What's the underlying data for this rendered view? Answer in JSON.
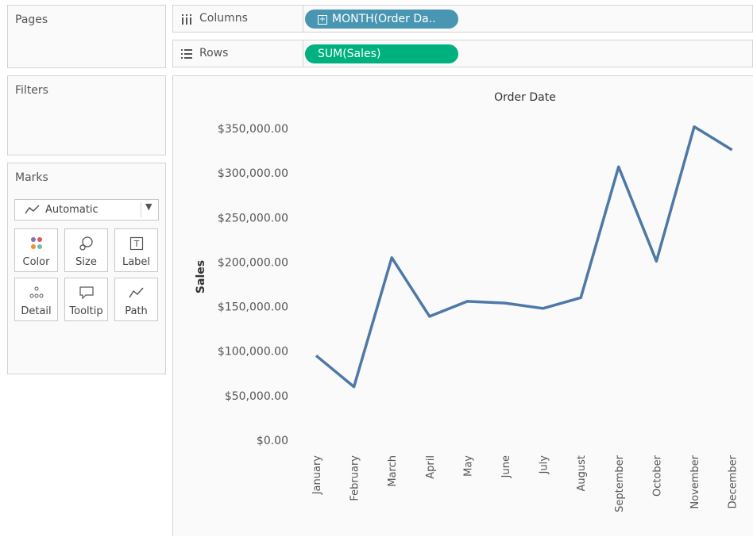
{
  "cards": {
    "pages_title": "Pages",
    "filters_title": "Filters",
    "marks_title": "Marks"
  },
  "marks": {
    "type_label": "Automatic",
    "type_icon": "line-chart-icon",
    "buttons": [
      {
        "label": "Color",
        "icon": "color-dots-icon"
      },
      {
        "label": "Size",
        "icon": "size-icon"
      },
      {
        "label": "Label",
        "icon": "text-label-icon"
      },
      {
        "label": "Detail",
        "icon": "detail-dots-icon"
      },
      {
        "label": "Tooltip",
        "icon": "tooltip-icon"
      },
      {
        "label": "Path",
        "icon": "path-icon"
      }
    ]
  },
  "shelves": {
    "columns_label": "Columns",
    "rows_label": "Rows",
    "columns_pill": "MONTH(Order Da..",
    "rows_pill": "SUM(Sales)",
    "columns_pill_color": "#4996b2",
    "rows_pill_color": "#00b180"
  },
  "chart_data": {
    "type": "line",
    "title": "Order Date",
    "xlabel": "",
    "ylabel": "Sales",
    "categories": [
      "January",
      "February",
      "March",
      "April",
      "May",
      "June",
      "July",
      "August",
      "September",
      "October",
      "November",
      "December"
    ],
    "series": [
      {
        "values": [
          95000,
          60000,
          205000,
          139000,
          156000,
          154000,
          148000,
          160000,
          307000,
          201000,
          352000,
          326000
        ]
      }
    ],
    "ylim": [
      0,
      350000
    ],
    "yticks": [
      0,
      50000,
      100000,
      150000,
      200000,
      250000,
      300000,
      350000
    ],
    "ytick_labels": [
      "$0.00",
      "$50,000.00",
      "$100,000.00",
      "$150,000.00",
      "$200,000.00",
      "$250,000.00",
      "$300,000.00",
      "$350,000.00"
    ],
    "line_color": "#4e79a7",
    "grid": false
  }
}
